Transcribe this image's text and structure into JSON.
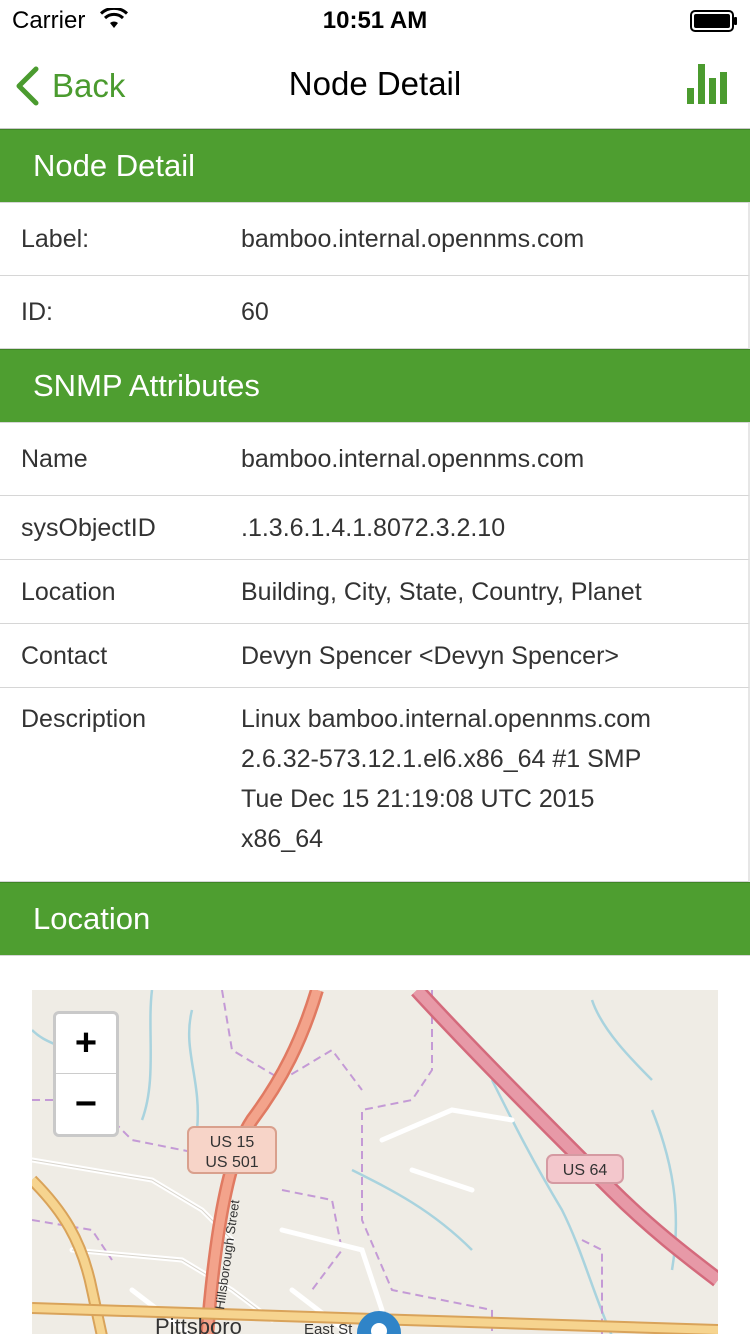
{
  "status_bar": {
    "carrier": "Carrier",
    "time": "10:51 AM"
  },
  "nav": {
    "back_label": "Back",
    "title": "Node Detail"
  },
  "sections": {
    "node_detail": {
      "header": "Node Detail",
      "rows": [
        {
          "label": "Label:",
          "value": "bamboo.internal.opennms.com"
        },
        {
          "label": "ID:",
          "value": "60"
        }
      ]
    },
    "snmp": {
      "header": "SNMP Attributes",
      "rows": [
        {
          "label": "Name",
          "value": "bamboo.internal.opennms.com"
        },
        {
          "label": "sysObjectID",
          "value": ".1.3.6.1.4.1.8072.3.2.10"
        },
        {
          "label": "Location",
          "value": "Building, City, State, Country, Planet"
        },
        {
          "label": "Contact",
          "value": "Devyn Spencer <Devyn Spencer>"
        },
        {
          "label": "Description",
          "lines": [
            "Linux bamboo.internal.opennms.com",
            "2.6.32-573.12.1.el6.x86_64 #1 SMP",
            "Tue Dec 15 21:19:08 UTC 2015",
            "x86_64"
          ]
        }
      ]
    },
    "location": {
      "header": "Location",
      "map": {
        "zoom_in": "+",
        "zoom_out": "−",
        "labels": {
          "us15_line1": "US 15",
          "us15_line2": "US 501",
          "us64": "US 64",
          "street": "Hillsborough Street",
          "town": "Pittsboro",
          "east_st": "East St"
        }
      }
    }
  },
  "colors": {
    "accent": "#4e9e30",
    "link": "#4b9b2f"
  }
}
